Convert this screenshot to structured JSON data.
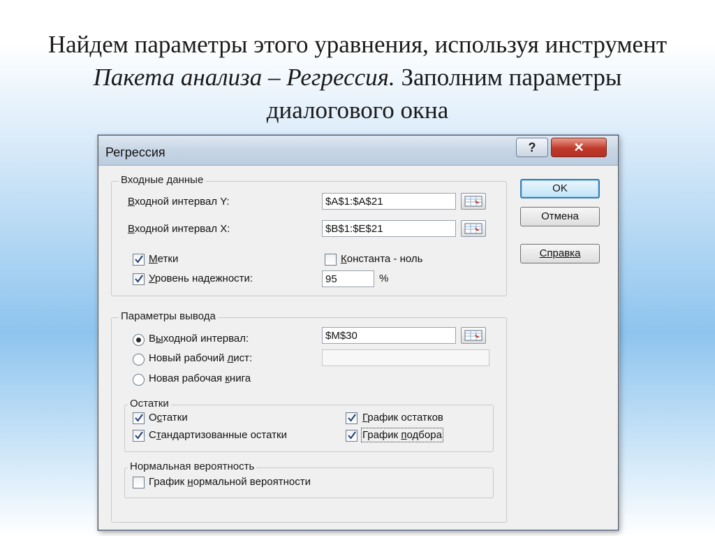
{
  "slide": {
    "title_part1": "Найдем параметры этого уравнения, используя инструмент ",
    "title_italic": "Пакета анализа – Регрессия.",
    "title_part2": " Заполним параметры диалогового окна"
  },
  "dialog": {
    "title": "Регрессия",
    "help_button": "?",
    "close_button": "✕",
    "buttons": {
      "ok": "OK",
      "cancel": "Отмена",
      "help": "Справка"
    },
    "input_group": {
      "label": "Входные данные",
      "y_range": {
        "label_pre": "В",
        "label_post": "ходной интервал Y:",
        "value": "$A$1:$A$21"
      },
      "x_range": {
        "label_pre": "В",
        "label_post": "ходной интервал X:",
        "value": "$B$1:$E$21"
      },
      "labels_checkbox": {
        "pre": "М",
        "post": "етки",
        "checked": true
      },
      "constant_zero": {
        "pre": "К",
        "post": "онстанта - ноль",
        "checked": false
      },
      "confidence": {
        "pre": "У",
        "post": "ровень надежности:",
        "checked": true,
        "value": "95",
        "unit": "%"
      }
    },
    "output_group": {
      "label": "Параметры вывода",
      "output_range": {
        "pre": "В",
        "underlined": "ы",
        "post": "ходной интервал:",
        "value": "$M$30",
        "selected": true
      },
      "new_sheet": {
        "pre": "Новый рабочий ",
        "underlined": "л",
        "post": "ист:",
        "value": "",
        "selected": false
      },
      "new_book": {
        "pre": "Новая рабочая ",
        "underlined": "к",
        "post": "нига",
        "selected": false
      }
    },
    "residuals_group": {
      "label": "Остатки",
      "residuals": {
        "pre": "О",
        "underlined": "с",
        "post": "татки",
        "checked": true
      },
      "standardized": {
        "pre": "С",
        "underlined": "т",
        "post": "андартизованные остатки",
        "checked": true
      },
      "residual_plot": {
        "pre": "",
        "underlined": "Г",
        "post": "рафик остатков",
        "checked": true
      },
      "fit_plot": {
        "pre": "График ",
        "underlined": "п",
        "post": "одбора",
        "checked": true
      }
    },
    "normal_group": {
      "label": "Нормальная вероятность",
      "normal_plot": {
        "pre": "График ",
        "underlined": "н",
        "post": "ормальной вероятности",
        "checked": false
      }
    }
  }
}
